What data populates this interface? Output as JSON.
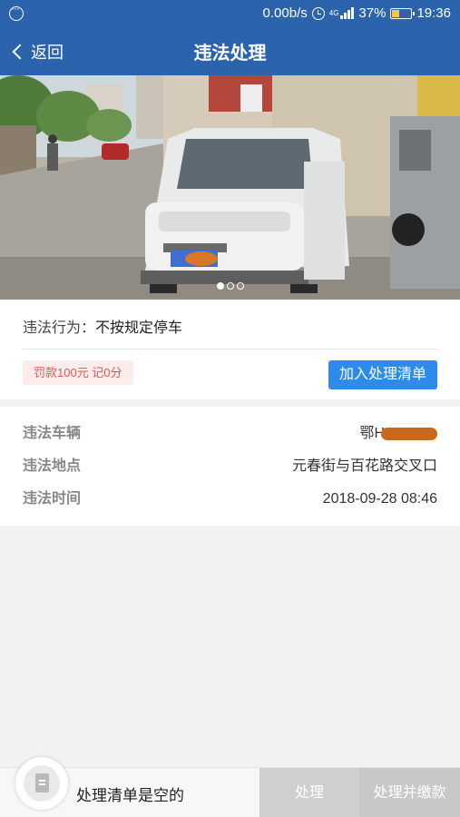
{
  "status_bar": {
    "net_speed": "0.00b/s",
    "network": "4G",
    "battery_percent": "37%",
    "battery_level": 0.37,
    "time": "19:36"
  },
  "nav": {
    "back_label": "返回",
    "title": "违法处理"
  },
  "photo": {
    "slide_count": 3,
    "active_slide": 1
  },
  "violation": {
    "behavior_label": "违法行为：",
    "behavior_value": "不按规定停车",
    "fine_badge": "罚款100元 记0分",
    "add_button": "加入处理清单"
  },
  "info": {
    "vehicle_label": "违法车辆",
    "vehicle_value": "鄂H",
    "location_label": "违法地点",
    "location_value": "元春街与百花路交叉口",
    "time_label": "违法时间",
    "time_value": "2018-09-28 08:46"
  },
  "bottom": {
    "empty_text": "处理清单是空的",
    "process_button": "处理",
    "process_pay_button": "处理并缴款"
  }
}
